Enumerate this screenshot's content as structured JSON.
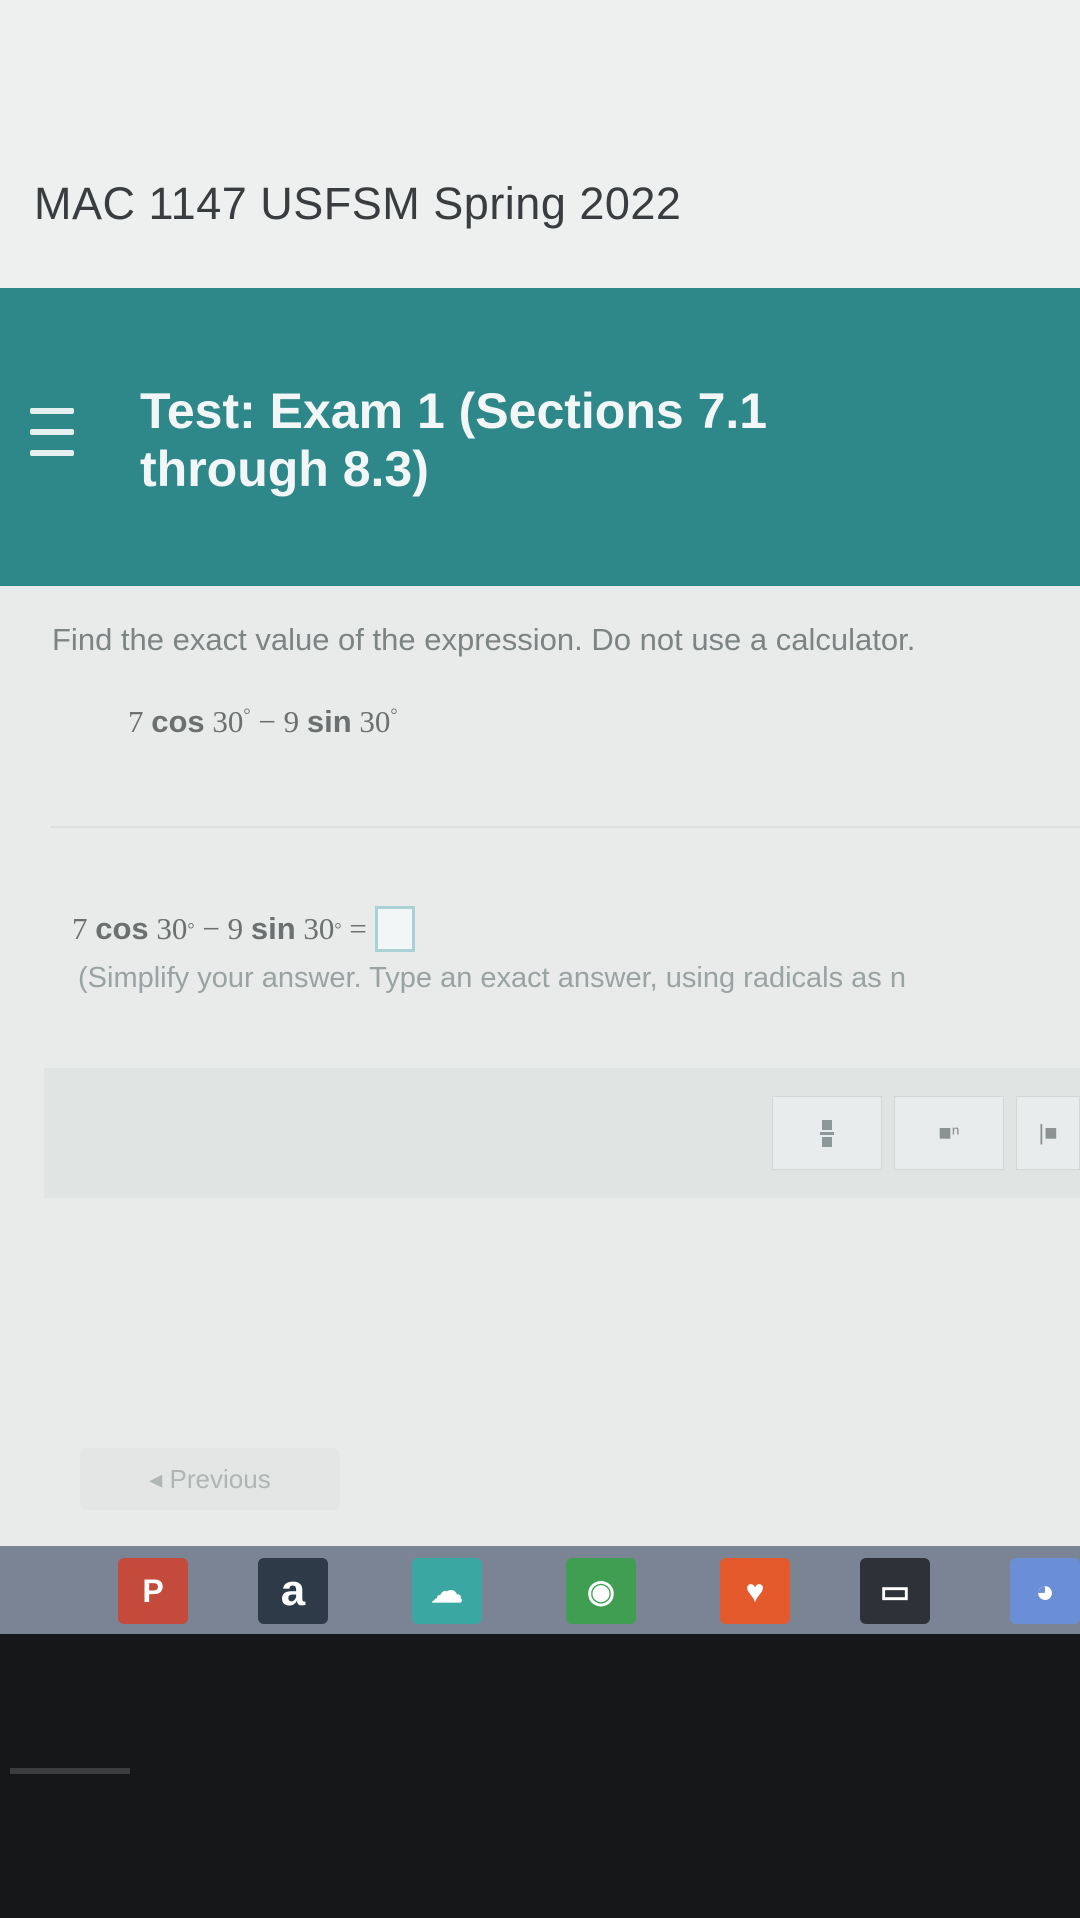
{
  "course": {
    "title": "MAC 1147 USFSM Spring 2022"
  },
  "test": {
    "title": "Test: Exam 1 (Sections 7.1 through 8.3)"
  },
  "question": {
    "instructions": "Find the exact value of the expression. Do not use a calculator.",
    "expression": {
      "c1": "7",
      "f1": "cos",
      "a1": "30",
      "op": "−",
      "c2": "9",
      "f2": "sin",
      "a2": "30",
      "deg": "°"
    },
    "equals": "=",
    "hint": "(Simplify your answer. Type an exact answer, using radicals as n"
  },
  "toolbar": {
    "buttons": [
      "fraction",
      "exponent",
      "absolute-value"
    ],
    "exponent_label": "■ⁿ",
    "abs_label": "|■"
  },
  "navigation": {
    "previous_label": "◂ Previous"
  },
  "taskbar": {
    "apps": [
      {
        "name": "pdf-app",
        "label": "P",
        "color": "#c44b3b"
      },
      {
        "name": "amazon-app",
        "label": "a",
        "color": "#2f3a48"
      },
      {
        "name": "cloud-app",
        "label": "☁",
        "color": "#3aa7a2"
      },
      {
        "name": "chrome-app",
        "label": "◉",
        "color": "#3f9e52"
      },
      {
        "name": "brave-app",
        "label": "♥",
        "color": "#e45a2c"
      },
      {
        "name": "card-app",
        "label": "▭",
        "color": "#2d3138"
      },
      {
        "name": "discord-app",
        "label": "◕",
        "color": "#6b8fd6"
      }
    ]
  }
}
